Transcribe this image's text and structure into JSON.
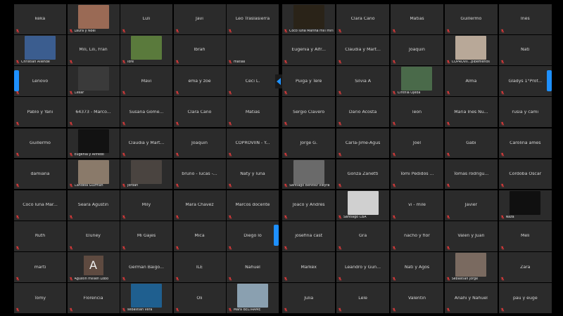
{
  "left_tiles": [
    {
      "name": "keka",
      "video": false
    },
    {
      "name": "",
      "video": true,
      "label": "Laura y Noel",
      "thumb": "#9a6a55"
    },
    {
      "name": "Luli",
      "video": false
    },
    {
      "name": "Javi",
      "video": false
    },
    {
      "name": "Leo Traslasierra",
      "video": false
    },
    {
      "name": "",
      "video": true,
      "label": "Christian Allende",
      "thumb": "#3b5d8f"
    },
    {
      "name": "Mili, Lili, Fran",
      "video": false
    },
    {
      "name": "",
      "video": true,
      "label": "lore",
      "thumb": "#5a7a3c"
    },
    {
      "name": "Ibrah",
      "video": false
    },
    {
      "name": "",
      "video": false,
      "label": "matias"
    },
    {
      "name": "Lenovo",
      "video": false
    },
    {
      "name": "",
      "video": true,
      "label": "Cesar",
      "thumb": "#3a3a3a"
    },
    {
      "name": "Mavi",
      "video": false
    },
    {
      "name": "ema y zoe",
      "video": false
    },
    {
      "name": "Ceci L.",
      "video": false
    },
    {
      "name": "Pablo y Yani",
      "video": false
    },
    {
      "name": "64373 - Marco...",
      "video": false
    },
    {
      "name": "Susana Góme...",
      "video": false
    },
    {
      "name": "Clara Cano",
      "video": false
    },
    {
      "name": "Matias",
      "video": false
    },
    {
      "name": "Guillermo",
      "video": false
    },
    {
      "name": "",
      "video": true,
      "label": "Eugenia y Alfredo",
      "thumb": "#121212"
    },
    {
      "name": "Claudia y Mart...",
      "video": false
    },
    {
      "name": "Joaquin",
      "video": false
    },
    {
      "name": "COPROVIIN - Y...",
      "video": false
    },
    {
      "name": "damiana",
      "video": false
    },
    {
      "name": "",
      "video": true,
      "label": "Candela Guzmán",
      "thumb": "#8a7a6a"
    },
    {
      "name": "",
      "video": true,
      "label": "jordan",
      "thumb": "#4a4440"
    },
    {
      "name": "bruno - lucas -...",
      "video": false
    },
    {
      "name": "Naty y luna",
      "video": false
    },
    {
      "name": "Coco luna Mar...",
      "video": false
    },
    {
      "name": "Seara Agustin",
      "video": false
    },
    {
      "name": "Mily",
      "video": false
    },
    {
      "name": "Mara Chavez",
      "video": false
    },
    {
      "name": "Marcos docente",
      "video": false
    },
    {
      "name": "Ruth",
      "video": false
    },
    {
      "name": "Eluney",
      "video": false
    },
    {
      "name": "Mi Gajes",
      "video": false
    },
    {
      "name": "Mica",
      "video": false
    },
    {
      "name": "Diego lo",
      "video": false
    },
    {
      "name": "marti",
      "video": false
    },
    {
      "name": "",
      "video": true,
      "label": "Agustin milsen Lobo",
      "avatar": "A"
    },
    {
      "name": "German Baigo...",
      "video": false
    },
    {
      "name": "ILE",
      "video": false
    },
    {
      "name": "Nahuel",
      "video": false
    },
    {
      "name": "Tomy",
      "video": false
    },
    {
      "name": "Florencia",
      "video": false
    },
    {
      "name": "",
      "video": true,
      "label": "sebastian vera",
      "thumb": "#1f5f8f"
    },
    {
      "name": "Oli",
      "video": false
    },
    {
      "name": "",
      "video": true,
      "label": "Mara BELTRAME",
      "thumb": "#8aa0b0"
    }
  ],
  "right_tiles": [
    {
      "name": "",
      "video": true,
      "label": "Coco luna Marina mili mirla Mar...",
      "thumb": "#2a2318"
    },
    {
      "name": "Clara Cano",
      "video": false
    },
    {
      "name": "Matias",
      "video": false
    },
    {
      "name": "Guillermo",
      "video": false
    },
    {
      "name": "Inés",
      "video": false
    },
    {
      "name": "Eugenia y Alfr...",
      "video": false
    },
    {
      "name": "Claudia y Mart...",
      "video": false
    },
    {
      "name": "Joaquin",
      "video": false
    },
    {
      "name": "",
      "video": true,
      "label": "COPROVII...pibemenos",
      "thumb": "#b8a898"
    },
    {
      "name": "Nati",
      "video": false
    },
    {
      "name": "Puiga y Tere",
      "video": false
    },
    {
      "name": "Silvia A",
      "video": false
    },
    {
      "name": "",
      "video": true,
      "label": "Cinthia Ojeda",
      "thumb": "#4a6a4a"
    },
    {
      "name": "Alma",
      "video": false
    },
    {
      "name": "Gladys 1°Prof...",
      "video": false
    },
    {
      "name": "Sergio Clavero",
      "video": false
    },
    {
      "name": "Dario Acosta",
      "video": false
    },
    {
      "name": "leon",
      "video": false
    },
    {
      "name": "Maria Ines Nu...",
      "video": false
    },
    {
      "name": "rusia y cami",
      "video": false
    },
    {
      "name": "Jorge G.",
      "video": false
    },
    {
      "name": "Carla-Jime-Agus",
      "video": false
    },
    {
      "name": "Joel",
      "video": false
    },
    {
      "name": "Gabi",
      "video": false
    },
    {
      "name": "Carolina ames",
      "video": false
    },
    {
      "name": "",
      "video": true,
      "label": "Santiago Benitez Vieyra",
      "thumb": "#6a6a6a"
    },
    {
      "name": "Gonza Zanetti",
      "video": false
    },
    {
      "name": "Tomi Pedidos ...",
      "video": false
    },
    {
      "name": "Tomas rodrigu...",
      "video": false
    },
    {
      "name": "Cordoba Oscar",
      "video": false
    },
    {
      "name": "Joaco y Andrés",
      "video": false
    },
    {
      "name": "",
      "video": true,
      "label": "Santiago CBA",
      "thumb": "#d0d0d0"
    },
    {
      "name": "vi - mile",
      "video": false
    },
    {
      "name": "Javier",
      "video": false
    },
    {
      "name": "",
      "video": true,
      "label": "Naza",
      "thumb": "#101010"
    },
    {
      "name": "josefina cast",
      "video": false
    },
    {
      "name": "Gra",
      "video": false
    },
    {
      "name": "nacho y flor",
      "video": false
    },
    {
      "name": "Valen y Juan",
      "video": false
    },
    {
      "name": "Meli",
      "video": false
    },
    {
      "name": "Markéx",
      "video": false
    },
    {
      "name": "Leandro y Gun...",
      "video": false
    },
    {
      "name": "Nati y Agos",
      "video": false
    },
    {
      "name": "",
      "video": true,
      "label": "Sebastian jorge",
      "thumb": "#7a6a60"
    },
    {
      "name": "Zara",
      "video": false
    },
    {
      "name": "Julia",
      "video": false
    },
    {
      "name": "Lele",
      "video": false
    },
    {
      "name": "Valentin",
      "video": false
    },
    {
      "name": "Anahi y Nahuel",
      "video": false
    },
    {
      "name": "pau y euge",
      "video": false
    }
  ],
  "colors": {
    "tile_bg": "#2b2b2b",
    "mute_red": "#e23b3b",
    "accent": "#1e90ff"
  }
}
